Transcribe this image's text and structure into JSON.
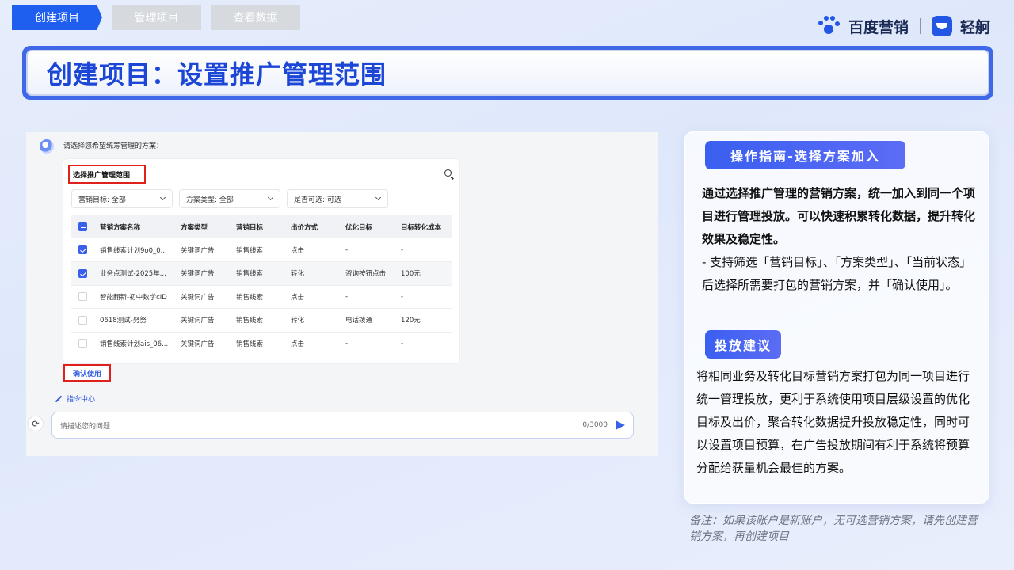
{
  "tabs": [
    "创建项目",
    "管理项目",
    "查看数据"
  ],
  "brand": {
    "left": "百度营销",
    "right": "轻舸"
  },
  "title": "创建项目：设置推广管理范围",
  "screenshot": {
    "prompt": "请选择您希望统筹管理的方案：",
    "card_title": "选择推广管理范围",
    "filters": [
      "营销目标: 全部",
      "方案类型: 全部",
      "是否可选: 可选"
    ],
    "columns": [
      "营销方案名称",
      "方案类型",
      "营销目标",
      "出价方式",
      "优化目标",
      "目标转化成本"
    ],
    "rows": [
      {
        "checked": true,
        "cells": [
          "销售线索计划9o0_0...",
          "关键词广告",
          "销售线索",
          "点击",
          "-",
          "-"
        ]
      },
      {
        "checked": true,
        "cells": [
          "业务点测试-2025年...",
          "关键词广告",
          "销售线索",
          "转化",
          "咨询按钮点击",
          "100元"
        ]
      },
      {
        "checked": false,
        "cells": [
          "智能翻新-初中数学cID",
          "关键词广告",
          "销售线索",
          "点击",
          "-",
          "-"
        ]
      },
      {
        "checked": false,
        "cells": [
          "0618测试-努努",
          "关键词广告",
          "销售线索",
          "转化",
          "电话拨通",
          "120元"
        ]
      },
      {
        "checked": false,
        "cells": [
          "销售线索计划ais_06...",
          "关键词广告",
          "销售线索",
          "点击",
          "-",
          "-"
        ]
      }
    ],
    "confirm": "确认使用",
    "command_center": "指令中心",
    "input_placeholder": "请描述您的问题",
    "char_count": "0/3000"
  },
  "guide": {
    "header": "操作指南-选择方案加入",
    "strong": "通过选择推广管理的营销方案，统一加入到同一个项目进行管理投放。可以快速积累转化数据，提升转化效果及稳定性。",
    "detail": "- 支持筛选「营销目标」、「方案类型」、「当前状态」后选择所需要打包的营销方案，并「确认使用」。",
    "advice_header": "投放建议",
    "advice": "将相同业务及转化目标营销方案打包为同一项目进行统一管理投放，更利于系统使用项目层级设置的优化目标及出价，聚合转化数据提升投放稳定性，同时可以设置项目预算，在广告投放期间有利于系统将预算分配给获量机会最佳的方案。"
  },
  "note": "备注：如果该账户是新账户，无可选营销方案，请先创建营销方案，再创建项目"
}
